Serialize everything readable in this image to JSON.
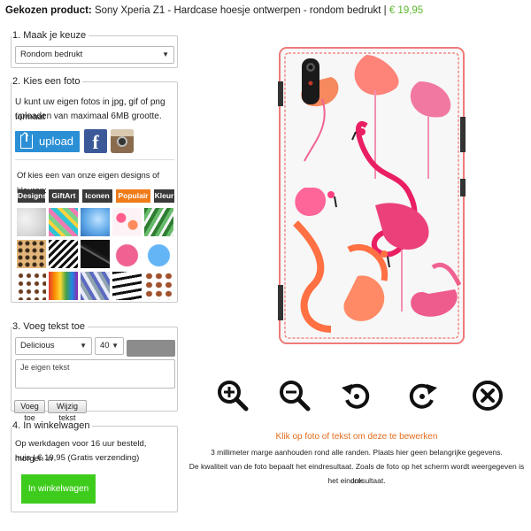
{
  "header": {
    "label": "Gekozen product:",
    "product": "Sony Xperia Z1 - Hardcase hoesje ontwerpen - rondom bedrukt",
    "separator": "|",
    "price": "€ 19,95"
  },
  "step1": {
    "title": "1. Maak je keuze",
    "select_value": "Rondom bedrukt"
  },
  "step2": {
    "title": "2. Kies een foto",
    "line1": "U kunt uw eigen fotos in jpg, gif of png formaat",
    "line2": "uploaden van maximaal 6MB grootte.",
    "upload_label": "upload",
    "facebook_letter": "f",
    "designs_intro": "Of kies een van onze eigen designs of kleuren:",
    "tabs": [
      "Designs",
      "GiftArt",
      "Iconen",
      "Populair",
      "Kleur"
    ],
    "active_tab": "Populair",
    "thumbnails": [
      "marble",
      "tropical-leaves",
      "blue-marble",
      "flamingos",
      "palm-leaves",
      "leopard",
      "chevron-zigzag",
      "black-marble",
      "pink-heart",
      "blue-heart",
      "coffee-beans",
      "paint-drips",
      "triangles",
      "brush-stripes",
      "lips"
    ]
  },
  "step3": {
    "title": "3. Voeg tekst toe",
    "font_value": "Delicious",
    "size_value": "40",
    "text_placeholder": "Je eigen tekst",
    "add_label": "Voeg toe",
    "edit_label": "Wijzig tekst",
    "text_color": "#8c8c8c"
  },
  "step4": {
    "title": "4. In winkelwagen",
    "line1": "Op werkdagen voor 16 uur besteld, morgen in",
    "line2": "huis | € 19,95 (Gratis verzending)",
    "cart_label": "In winkelwagen"
  },
  "toolbar": {
    "icons": [
      "zoom-in-icon",
      "zoom-out-icon",
      "rotate-left-icon",
      "rotate-right-icon",
      "delete-icon"
    ]
  },
  "info": {
    "hint": "Klik op foto of tekst om deze te bewerken",
    "line1": "3 millimeter marge aanhouden rond alle randen. Plaats hier geen belangrijke gegevens.",
    "line2": "De kwaliteit van de foto bepaalt het eindresultaat. Zoals de foto op het scherm wordt weergegeven is ook",
    "line3": "het eindresultaat."
  },
  "colors": {
    "accent_orange": "#f07b19",
    "price_green": "#5cb82e",
    "upload_blue": "#2b8fd6",
    "cart_green": "#3ecc1c"
  }
}
